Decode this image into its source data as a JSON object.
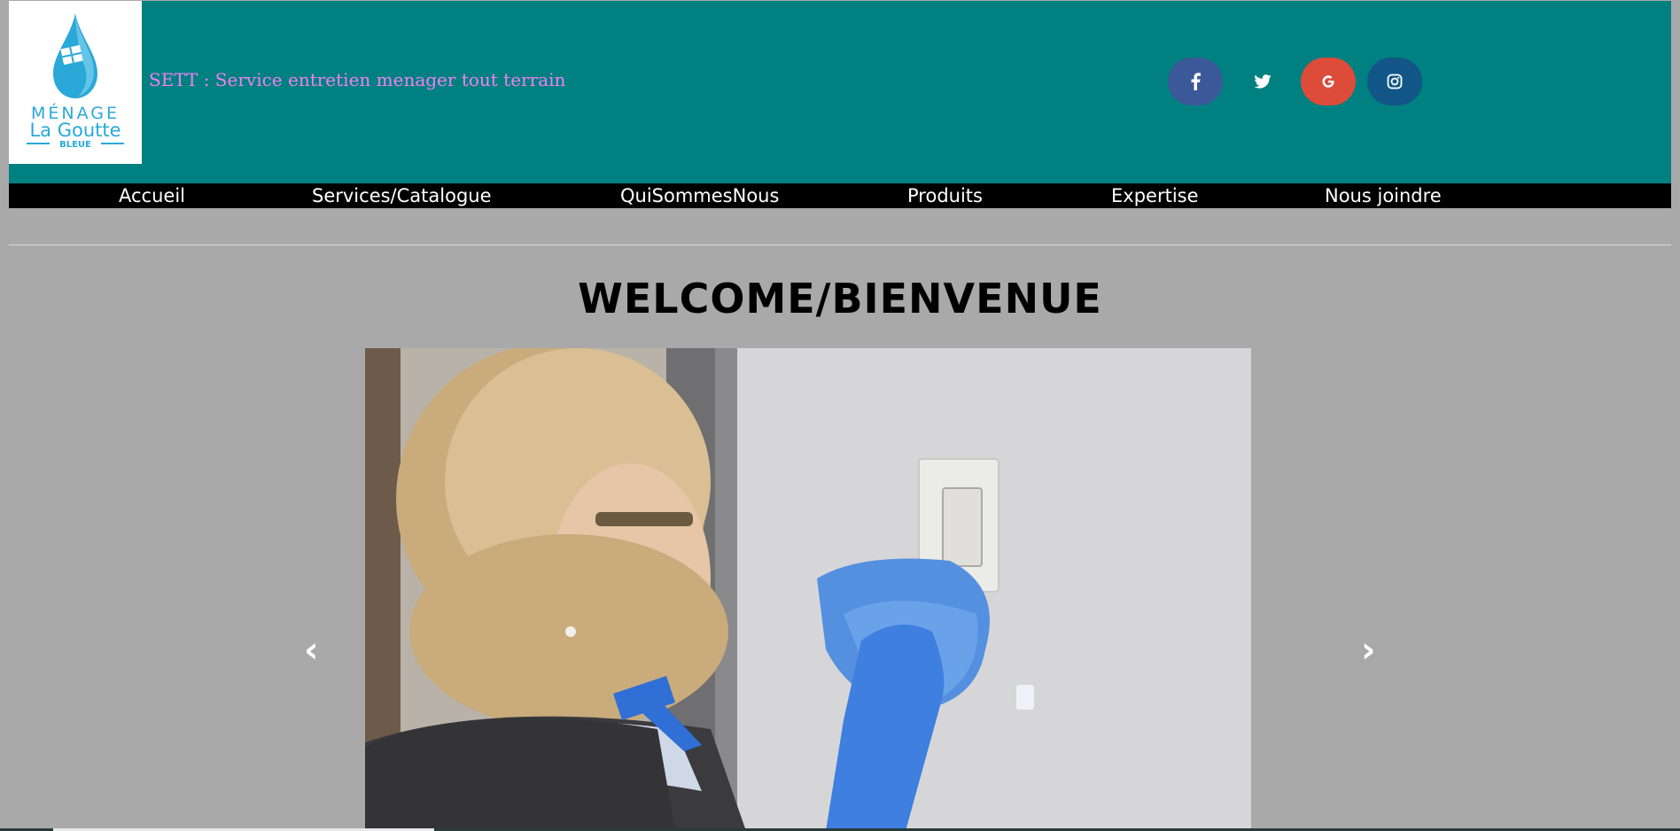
{
  "header": {
    "logo": {
      "line1": "MÉNAGE",
      "line2": "La Goutte",
      "line3": "BLEUE"
    },
    "tagline": "SETT : Service entretien menager tout terrain",
    "social": [
      {
        "name": "facebook",
        "icon": "facebook-icon",
        "color": "#3b5998"
      },
      {
        "name": "twitter",
        "icon": "twitter-icon",
        "color": "#008080"
      },
      {
        "name": "google",
        "icon": "google-icon",
        "color": "#dd4b39"
      },
      {
        "name": "instagram",
        "icon": "instagram-icon",
        "color": "#125688"
      }
    ]
  },
  "nav": {
    "items": [
      {
        "label": "Accueil"
      },
      {
        "label": "Services/Catalogue"
      },
      {
        "label": "QuiSommesNous"
      },
      {
        "label": "Produits"
      },
      {
        "label": "Expertise"
      },
      {
        "label": "Nous joindre"
      }
    ]
  },
  "main": {
    "title": "WELCOME/BIENVENUE",
    "carousel": {
      "prev_label": "‹",
      "next_label": "›"
    }
  },
  "colors": {
    "header_bg": "#008080",
    "nav_bg": "#000000",
    "page_bg": "#a9a9a9",
    "tagline": "#ee82ee"
  }
}
